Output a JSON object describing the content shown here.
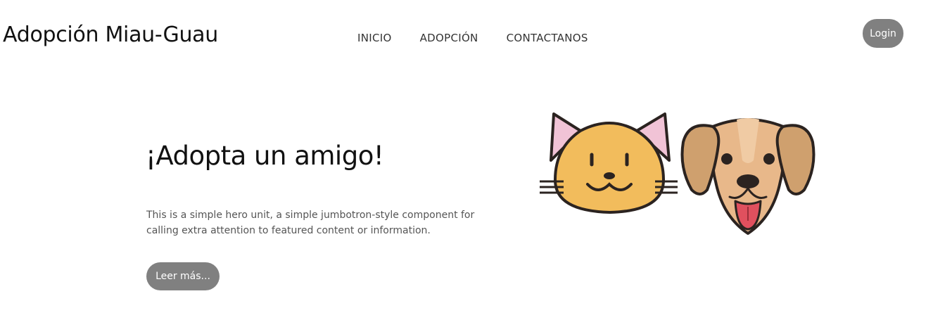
{
  "header": {
    "brand": "Adopción Miau-Guau",
    "nav": [
      {
        "label": "INICIO"
      },
      {
        "label": "ADOPCIÓN"
      },
      {
        "label": "CONTACTANOS"
      }
    ],
    "login_label": "Login"
  },
  "hero": {
    "title": "¡Adopta un amigo!",
    "lead": "This is a simple hero unit, a simple jumbotron-style component for calling extra attention to featured content or information.",
    "button_label": "Leer más...",
    "image": "cat-and-dog-faces"
  },
  "colors": {
    "button_bg": "#808080",
    "button_text": "#ffffff",
    "cat_fur": "#F2BC5C",
    "cat_ear_inner": "#F1C3D6",
    "dog_fur": "#E8B88A",
    "dog_ears": "#CFA06E",
    "dog_tongue": "#E0505E"
  }
}
